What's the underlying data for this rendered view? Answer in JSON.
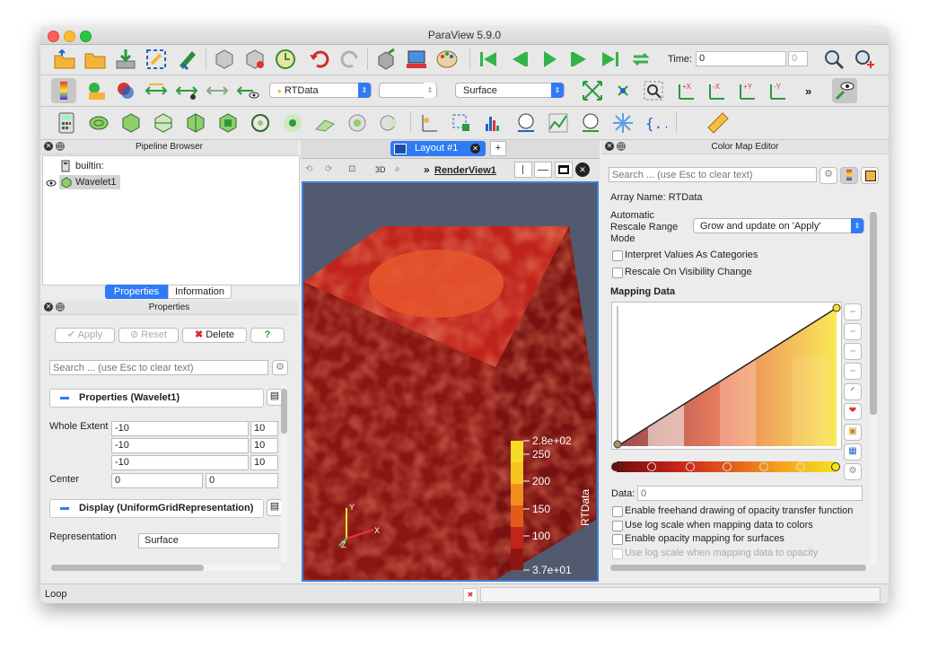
{
  "window": {
    "title": "ParaView 5.9.0"
  },
  "toolbar": {
    "time_label": "Time:",
    "time_value": "0",
    "time_index": "0"
  },
  "selectors": {
    "source": "RTData",
    "component": "",
    "representation": "Surface"
  },
  "pipeline": {
    "header": "Pipeline Browser",
    "items": [
      {
        "label": "builtin:"
      },
      {
        "label": "Wavelet1"
      }
    ]
  },
  "tabs": {
    "properties": "Properties",
    "information": "Information"
  },
  "properties": {
    "header": "Properties",
    "apply": "Apply",
    "reset": "Reset",
    "delete": "Delete",
    "help": "?",
    "search_placeholder": "Search ... (use Esc to clear text)",
    "section1": "Properties (Wavelet1)",
    "whole_extent_label": "Whole Extent",
    "extent": [
      [
        "-10",
        "10"
      ],
      [
        "-10",
        "10"
      ],
      [
        "-10",
        "10"
      ]
    ],
    "center_label": "Center",
    "center": [
      "0",
      "0"
    ],
    "section2": "Display (UniformGridRepresentation)",
    "representation_label": "Representation",
    "representation_value": "Surface"
  },
  "layout": {
    "tab_label": "Layout #1",
    "add": "+",
    "view_name": "RenderView1",
    "mode_3d": "3D"
  },
  "render": {
    "background": "#525a70",
    "scalar_bar": {
      "title": "RTData",
      "labels": [
        "2.8e+02",
        "250",
        "200",
        "150",
        "100",
        "3.7e+01"
      ]
    },
    "axes": {
      "x": "X",
      "y": "Y",
      "z": "Z"
    }
  },
  "colormap": {
    "header": "Color Map Editor",
    "search_placeholder": "Search ... (use Esc to clear text)",
    "array_name": "Array Name: RTData",
    "auto_rescale_label": "Automatic Rescale Range Mode",
    "auto_rescale_value": "Grow and update on 'Apply'",
    "interpret": "Interpret Values As Categories",
    "rescale_visibility": "Rescale On Visibility Change",
    "mapping_data": "Mapping Data",
    "data_label": "Data:",
    "data_placeholder": "0",
    "options": [
      "Enable freehand drawing of opacity transfer function",
      "Use log scale when mapping data to colors",
      "Enable opacity mapping for surfaces",
      "Use log scale when mapping data to opacity"
    ]
  },
  "status": {
    "text": "Loop"
  }
}
